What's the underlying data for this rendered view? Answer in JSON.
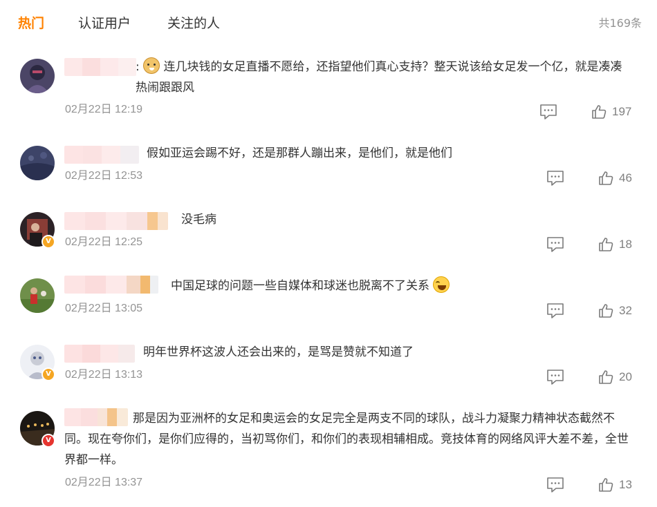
{
  "tabs": [
    {
      "label": "热门",
      "active": true
    },
    {
      "label": "认证用户",
      "active": false
    },
    {
      "label": "关注的人",
      "active": false
    }
  ],
  "total": "共169条",
  "comments": [
    {
      "text": ": 连几块钱的女足直播不愿给，还指望他们真心支持？整天说该给女足发一个亿，就是凑凑热闹跟跟风",
      "text_before_emoji": ":",
      "text_after_emoji": "连几块钱的女足直播不愿给，还指望他们真心支持？整天说该给女足发一个亿，就是凑凑热闹跟跟风",
      "time": "02月22日 12:19",
      "likes": "197",
      "emoji": "doge-icon",
      "verified": null
    },
    {
      "text": "假如亚运会踢不好，还是那群人蹦出来，是他们，就是他们",
      "time": "02月22日 12:53",
      "likes": "46",
      "verified": null
    },
    {
      "text": "没毛病",
      "time": "02月22日 12:25",
      "likes": "18",
      "verified": "gold"
    },
    {
      "text": "中国足球的问题一些自媒体和球迷也脱离不了关系",
      "time": "02月22日 13:05",
      "likes": "32",
      "emoji": "laughing-tears-icon",
      "verified": null
    },
    {
      "text": "明年世界杯这波人还会出来的，是骂是赞就不知道了",
      "time": "02月22日 13:13",
      "likes": "20",
      "verified": "gold"
    },
    {
      "text": "那是因为亚洲杯的女足和奥运会的女足完全是两支不同的球队，战斗力凝聚力精神状态截然不同。现在夸你们，是你们应得的，当初骂你们，和你们的表现相辅相成。竞技体育的网络风评大差不差，全世界都一样。",
      "time": "02月22日 13:37",
      "likes": "13",
      "verified": "red"
    }
  ],
  "colors": {
    "accent": "#ff8200",
    "muted": "#939393",
    "text": "#333333",
    "verified_gold": "#f5a623",
    "verified_red": "#e6352f"
  },
  "icons": {
    "reply": "comment-icon",
    "like": "thumbs-up-icon",
    "verified": "verified-v-icon"
  }
}
